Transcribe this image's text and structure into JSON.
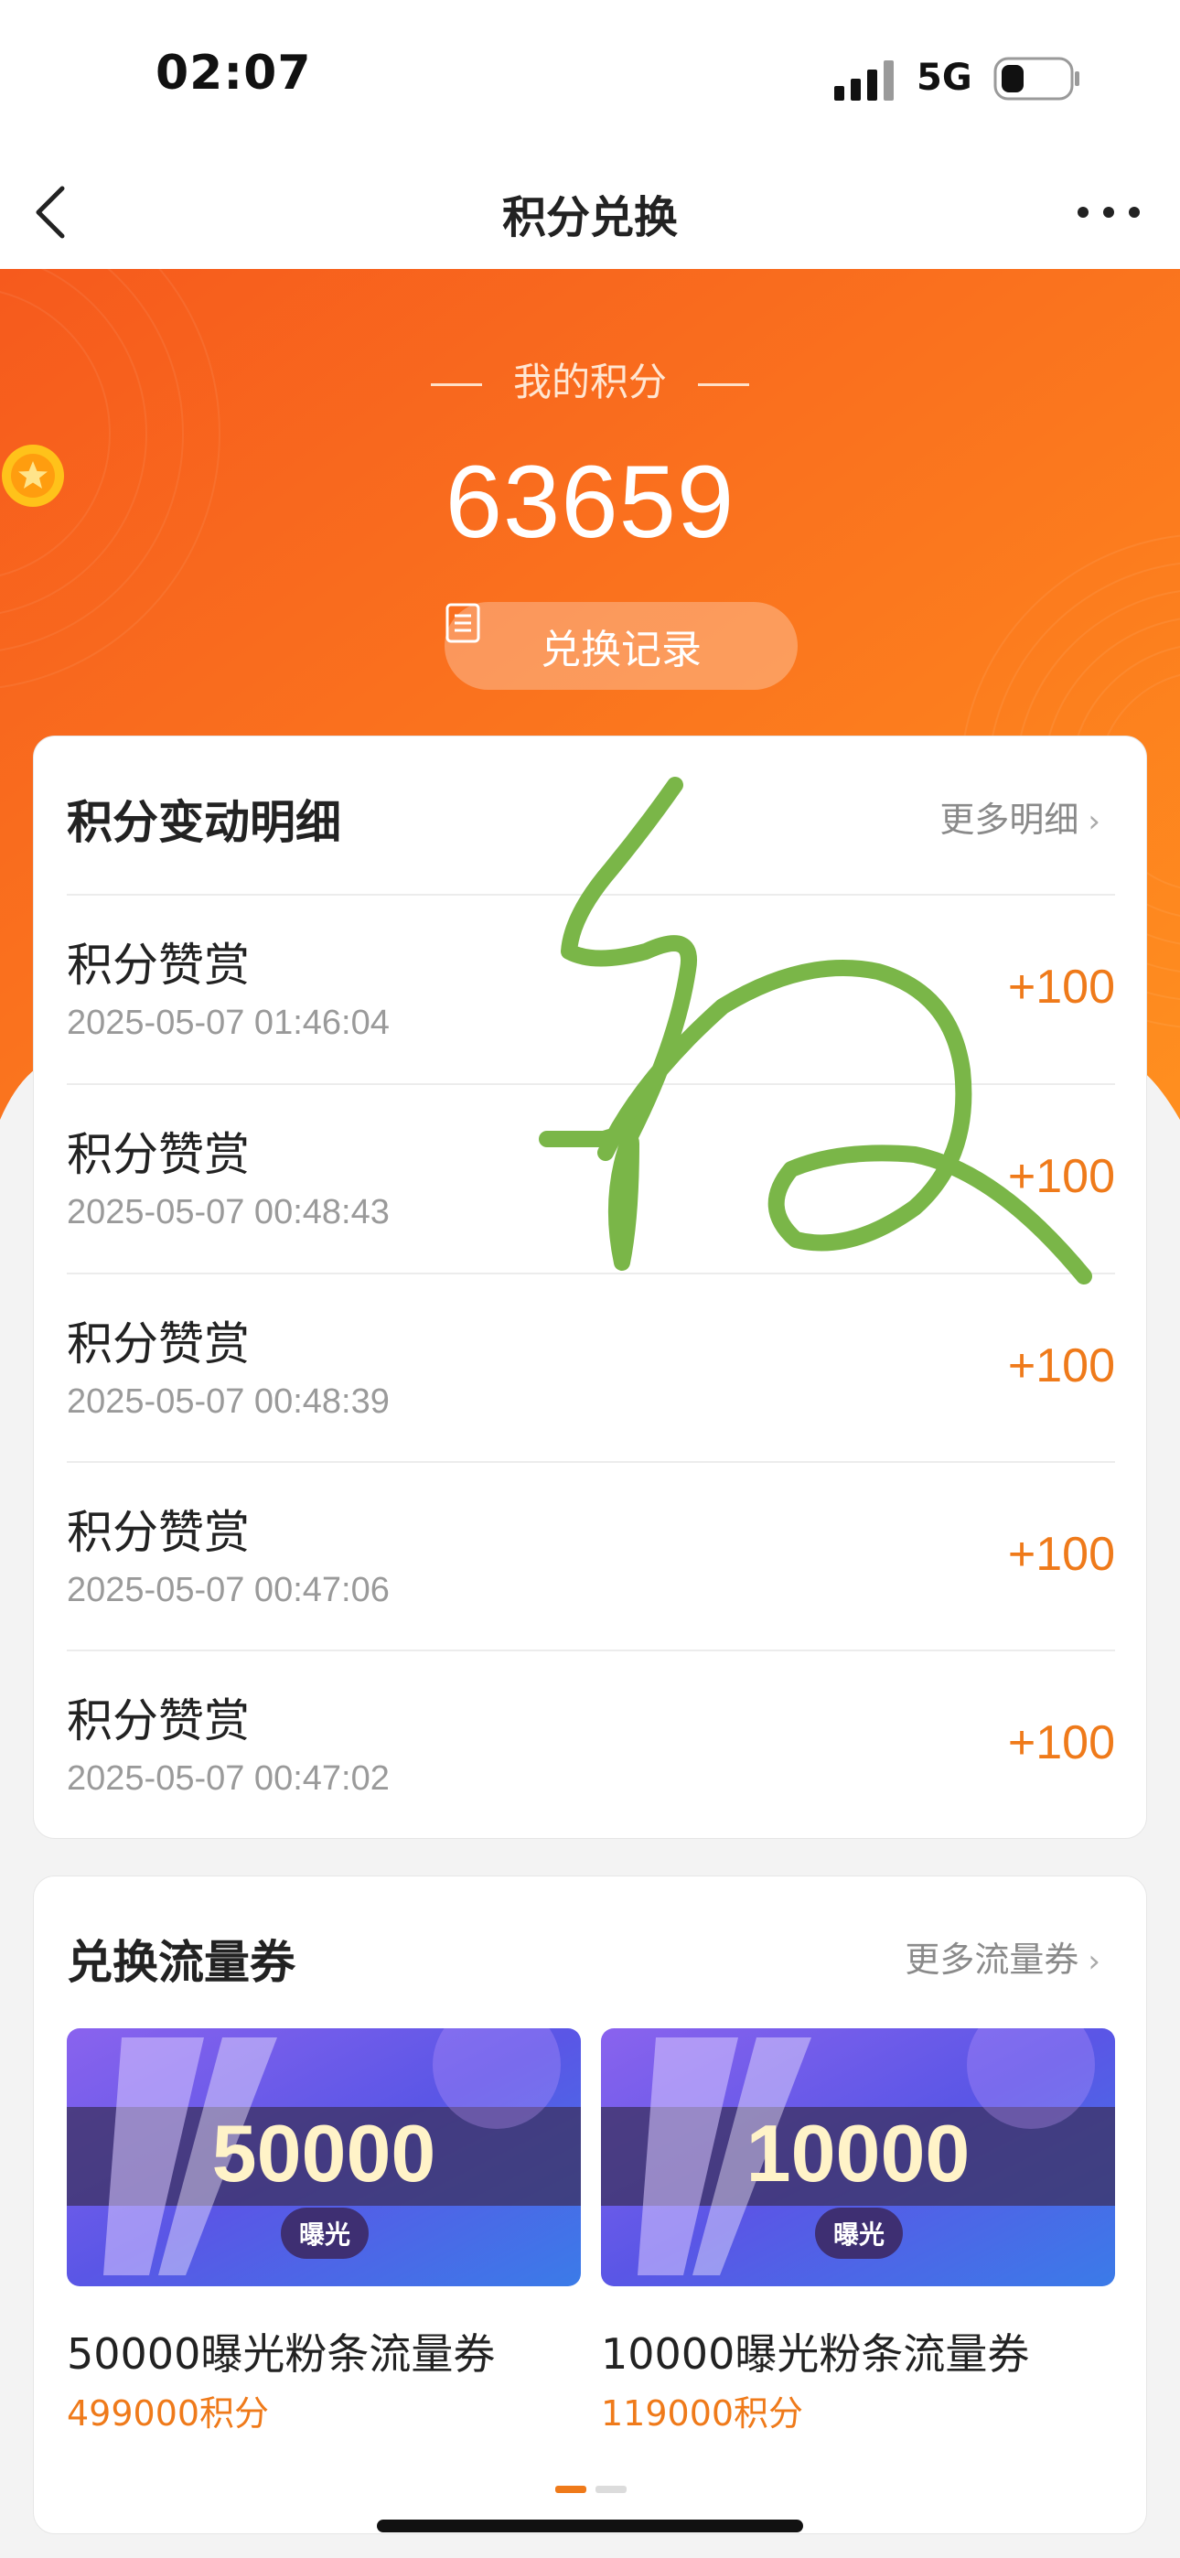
{
  "status_bar": {
    "time": "02:07",
    "network": "5G"
  },
  "nav": {
    "title": "积分兑换"
  },
  "hero": {
    "label": "我的积分",
    "points": "63659",
    "record_button": "兑换记录",
    "colors": {
      "top": "#f9681f",
      "bottom": "#ff8e1e"
    }
  },
  "points_detail": {
    "title": "积分变动明细",
    "more": "更多明细",
    "rows": [
      {
        "title": "积分赞赏",
        "time": "2025-05-07 01:46:04",
        "amount": "+100"
      },
      {
        "title": "积分赞赏",
        "time": "2025-05-07 00:48:43",
        "amount": "+100"
      },
      {
        "title": "积分赞赏",
        "time": "2025-05-07 00:48:39",
        "amount": "+100"
      },
      {
        "title": "积分赞赏",
        "time": "2025-05-07 00:47:06",
        "amount": "+100"
      },
      {
        "title": "积分赞赏",
        "time": "2025-05-07 00:47:02",
        "amount": "+100"
      }
    ]
  },
  "coupons": {
    "title": "兑换流量券",
    "more": "更多流量券",
    "items": [
      {
        "number": "50000",
        "tag": "曝光",
        "name": "50000曝光粉条流量券",
        "price": "499000积分"
      },
      {
        "number": "10000",
        "tag": "曝光",
        "name": "10000曝光粉条流量券",
        "price": "119000积分"
      }
    ]
  },
  "colors": {
    "accent": "#ef7a1a",
    "scribble": "#7ab648"
  }
}
